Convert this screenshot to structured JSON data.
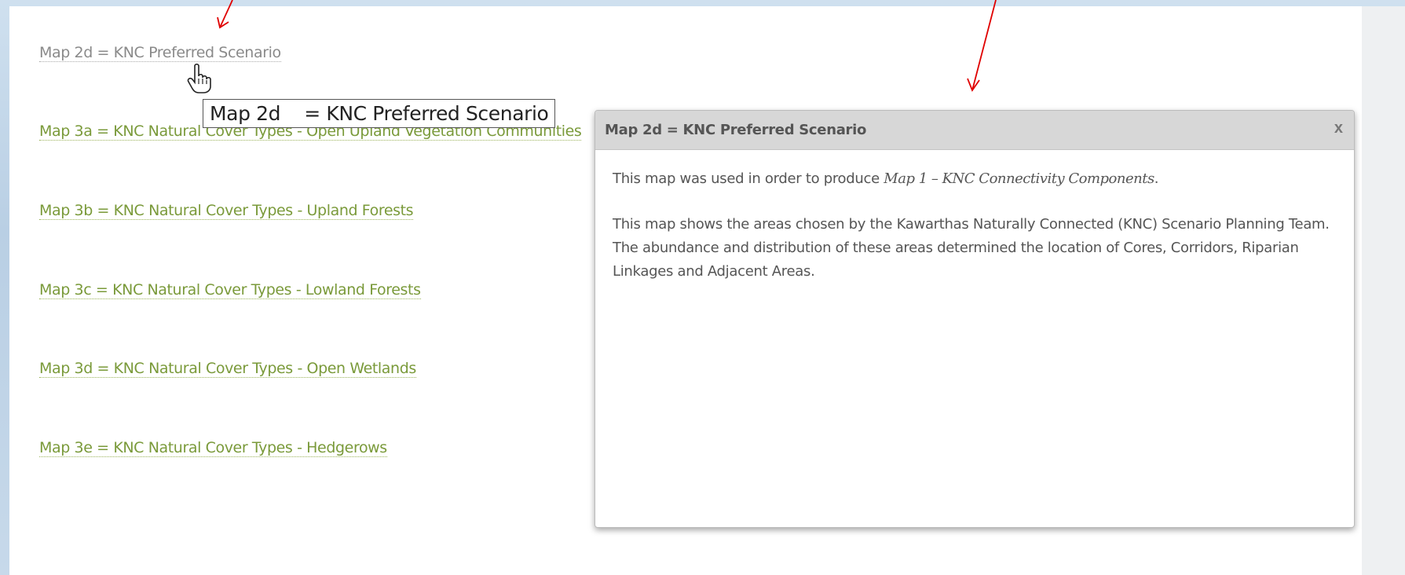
{
  "links": [
    {
      "label": "Map 2d = KNC Preferred Scenario",
      "visited": true
    },
    {
      "label": "Map 3a = KNC Natural Cover Types - Open Upland Vegetation Communities",
      "visited": false
    },
    {
      "label": "Map 3b = KNC Natural Cover Types - Upland Forests",
      "visited": false
    },
    {
      "label": "Map 3c = KNC Natural Cover Types - Lowland Forests",
      "visited": false
    },
    {
      "label": "Map 3d = KNC Natural Cover Types - Open Wetlands",
      "visited": false
    },
    {
      "label": "Map 3e = KNC Natural Cover Types - Hedgerows",
      "visited": false
    }
  ],
  "tooltip": {
    "text": "Map 2d    = KNC Preferred Scenario"
  },
  "dialog": {
    "title": "Map 2d = KNC Preferred Scenario",
    "close": "x",
    "p1_prefix": "This map was used in order to produce ",
    "p1_italic": "Map 1 – KNC Connectivity Components",
    "p1_suffix": ".",
    "p2": "This map shows the areas chosen by the Kawarthas Naturally Connected (KNC) Scenario Planning Team.  The abundance and distribution of these areas determined the location of Cores, Corridors, Riparian Linkages and Adjacent Areas."
  },
  "colors": {
    "link": "#7a9a3a",
    "visited_link": "#8a8a8a",
    "dialog_header": "#d7d7d7",
    "annotation_arrow": "#e00000"
  }
}
